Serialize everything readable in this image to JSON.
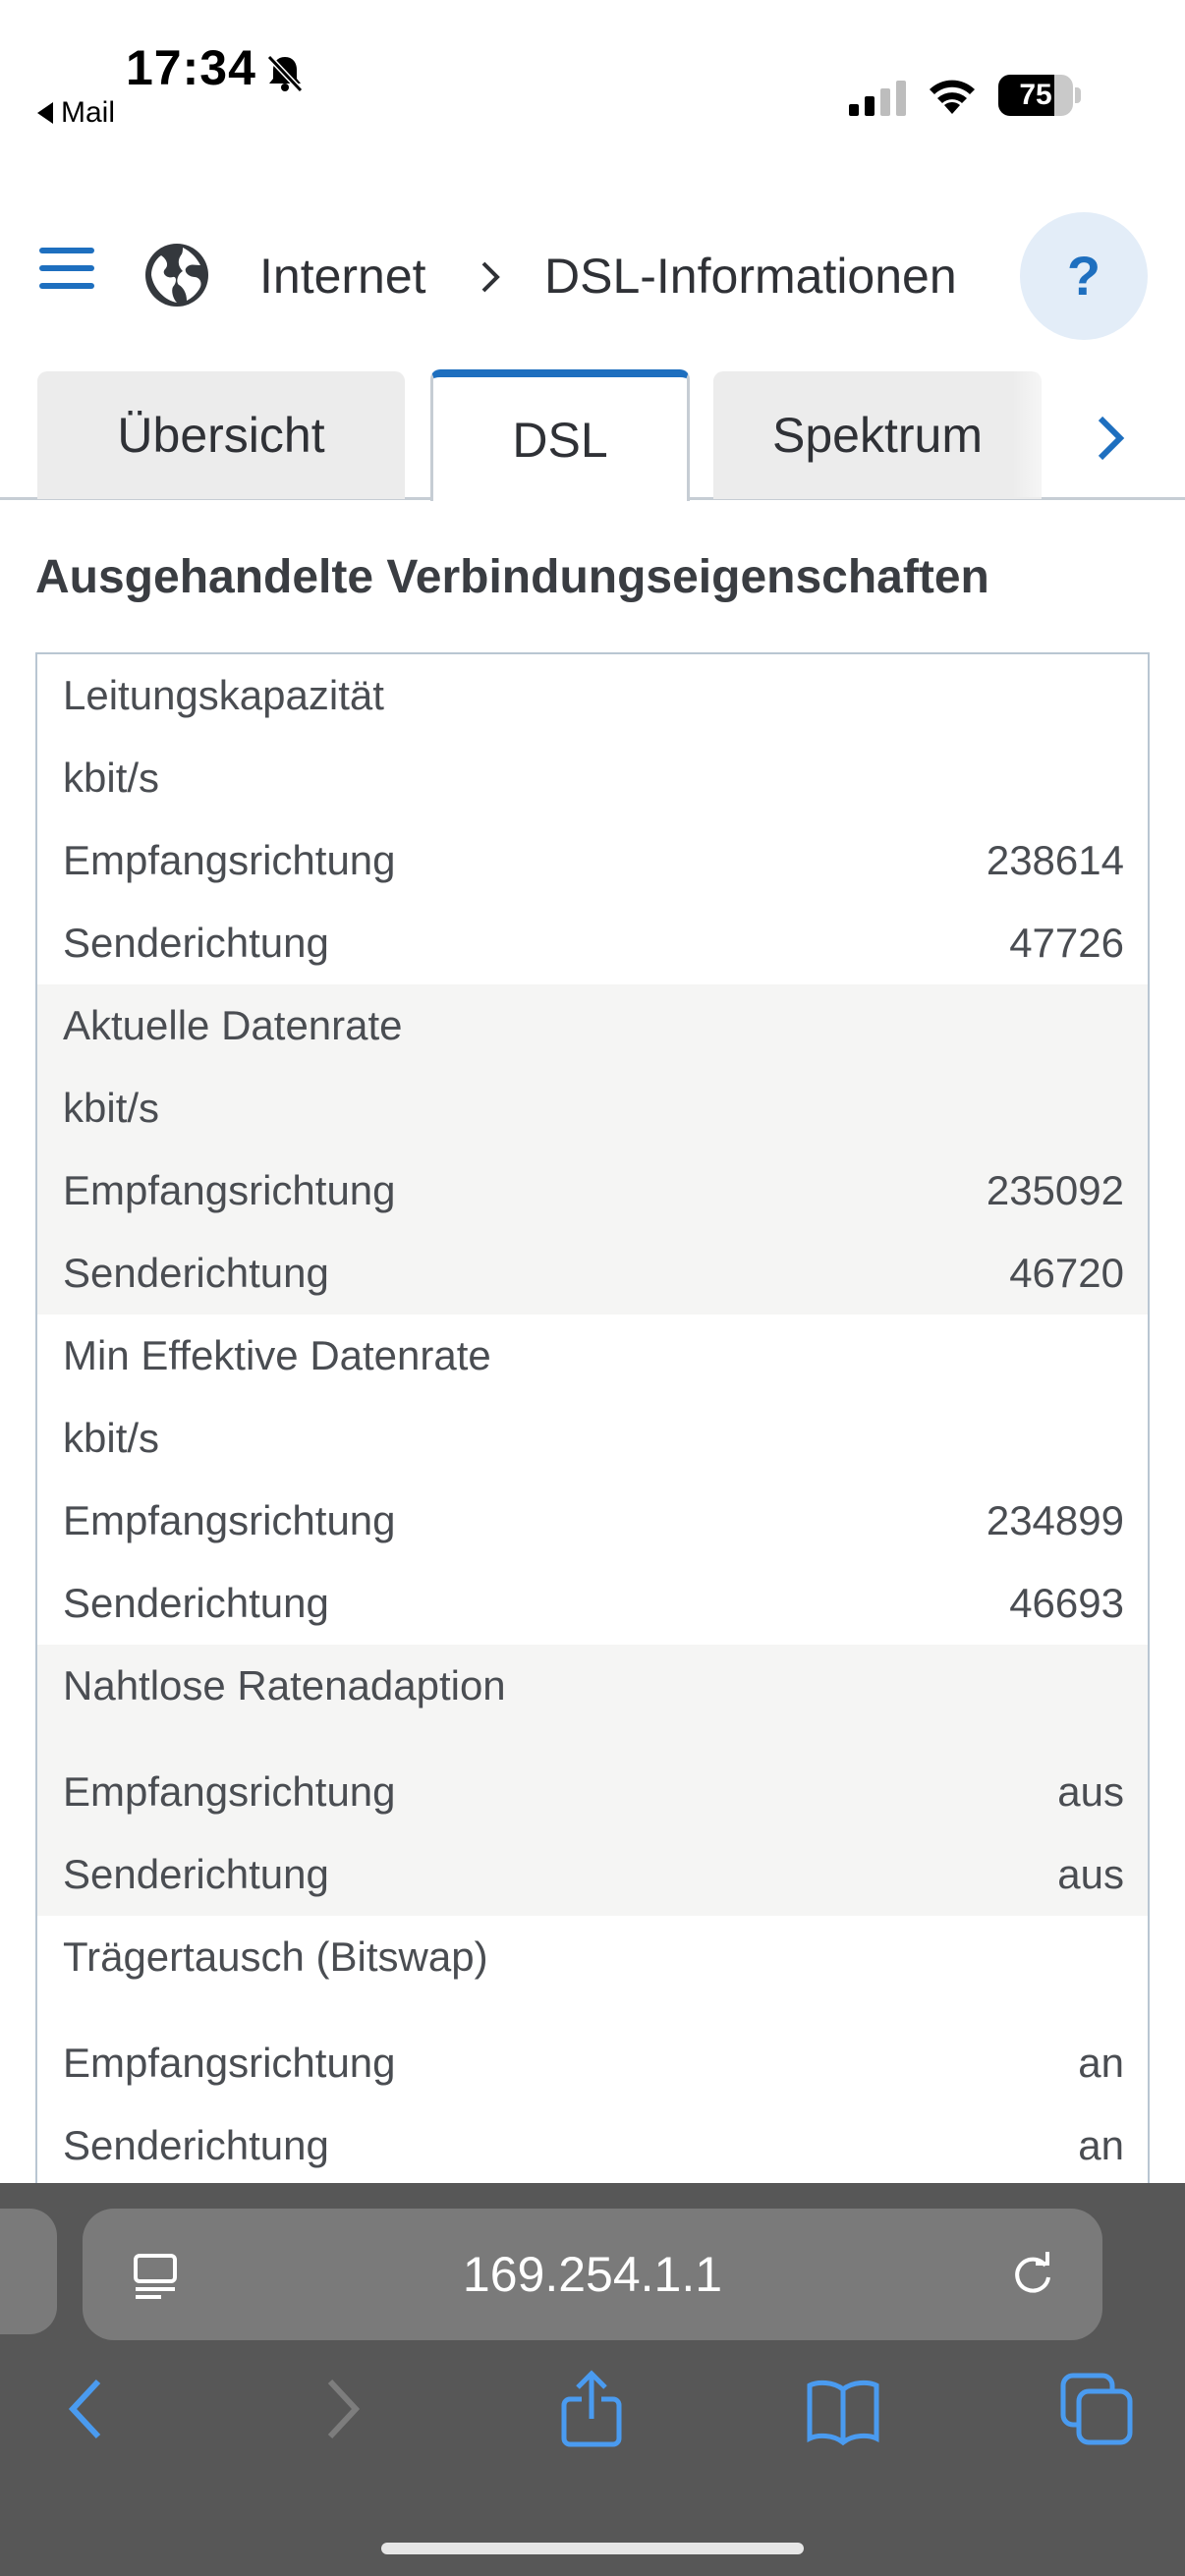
{
  "status_bar": {
    "time": "17:34",
    "back_label": "Mail",
    "battery_percent": "75",
    "battery_level": 0.75,
    "icons": [
      "bell-slash-icon",
      "cellular-signal-icon",
      "wifi-icon",
      "battery-icon"
    ]
  },
  "header": {
    "breadcrumb_root": "Internet",
    "breadcrumb_current": "DSL-Informationen",
    "help_label": "?",
    "icons": [
      "menu-icon",
      "globe-icon",
      "chevron-right-icon"
    ]
  },
  "tabs": [
    {
      "label": "Übersicht",
      "active": false
    },
    {
      "label": "DSL",
      "active": true
    },
    {
      "label": "Spektrum",
      "active": false
    }
  ],
  "section": {
    "title": "Ausgehandelte Verbindungseigenschaften"
  },
  "properties": {
    "groups": [
      {
        "title": "Leitungskapazität",
        "unit": "kbit/s",
        "rows": [
          {
            "label": "Empfangsrichtung",
            "value": "238614"
          },
          {
            "label": "Senderichtung",
            "value": "47726"
          }
        ]
      },
      {
        "title": "Aktuelle Datenrate",
        "unit": "kbit/s",
        "rows": [
          {
            "label": "Empfangsrichtung",
            "value": "235092"
          },
          {
            "label": "Senderichtung",
            "value": "46720"
          }
        ]
      },
      {
        "title": "Min Effektive Datenrate",
        "unit": "kbit/s",
        "rows": [
          {
            "label": "Empfangsrichtung",
            "value": "234899"
          },
          {
            "label": "Senderichtung",
            "value": "46693"
          }
        ]
      },
      {
        "title": "Nahtlose Ratenadaption",
        "unit": "",
        "rows": [
          {
            "label": "Empfangsrichtung",
            "value": "aus"
          },
          {
            "label": "Senderichtung",
            "value": "aus"
          }
        ]
      },
      {
        "title": "Trägertausch (Bitswap)",
        "unit": "",
        "rows": [
          {
            "label": "Empfangsrichtung",
            "value": "an"
          },
          {
            "label": "Senderichtung",
            "value": "an"
          }
        ]
      }
    ]
  },
  "browser": {
    "url": "169.254.1.1",
    "toolbar_icons": [
      "back-icon",
      "forward-icon",
      "share-icon",
      "bookmarks-icon",
      "tabs-icon"
    ],
    "accent_color": "#1e6fbf"
  }
}
